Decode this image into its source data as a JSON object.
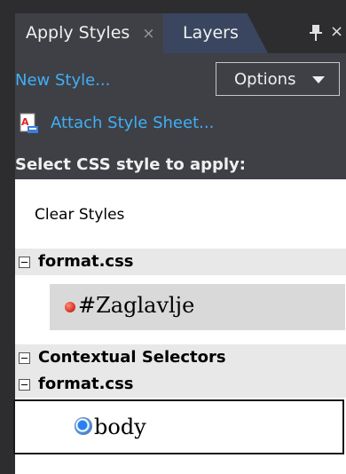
{
  "tabs": {
    "active_label": "Apply Styles",
    "active_close": "×",
    "inactive_label": "Layers",
    "window_close": "×"
  },
  "toolbar": {
    "new_style_label": "New Style...",
    "options_label": "Options",
    "attach_label": "Attach Style Sheet..."
  },
  "header": {
    "label": "Select CSS style to apply:"
  },
  "list": {
    "clear_styles": "Clear Styles",
    "groups": [
      {
        "label": "format.css"
      },
      {
        "label": "Contextual Selectors"
      },
      {
        "label": "format.css"
      }
    ],
    "selectors": [
      {
        "label": "#Zaglavlje"
      },
      {
        "label": "body"
      }
    ]
  },
  "colors": {
    "panel_background": "#2d2d30",
    "link_blue": "#3fb0f4",
    "inactive_tab": "#3a4660",
    "selection_gray": "#d9d9d9"
  }
}
